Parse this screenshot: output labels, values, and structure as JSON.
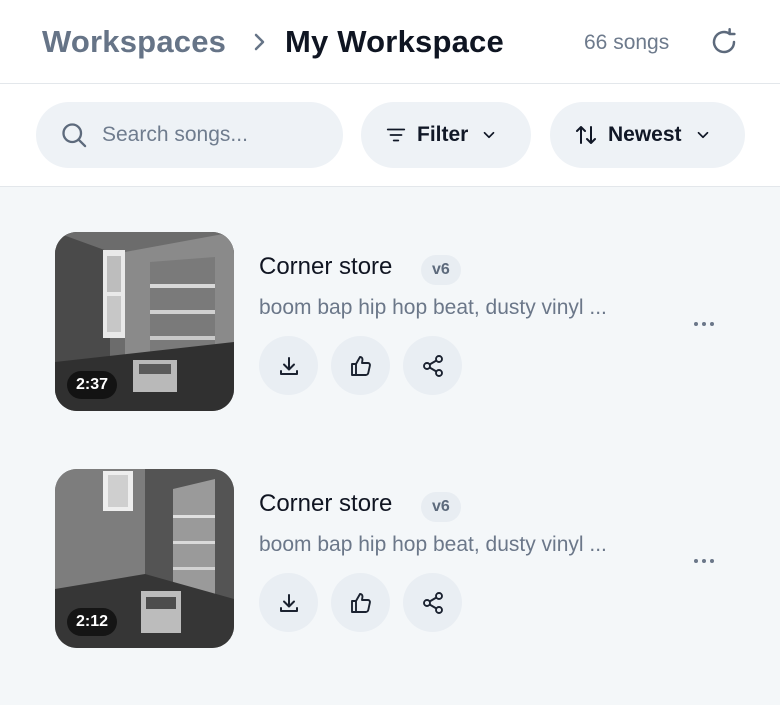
{
  "header": {
    "breadcrumb_root": "Workspaces",
    "breadcrumb_current": "My Workspace",
    "song_count": "66 songs"
  },
  "toolbar": {
    "search_placeholder": "Search songs...",
    "filter_label": "Filter",
    "sort_label": "Newest"
  },
  "songs": [
    {
      "title": "Corner store",
      "version": "v6",
      "description": "boom bap hip hop beat, dusty vinyl ...",
      "duration": "2:37"
    },
    {
      "title": "Corner store",
      "version": "v6",
      "description": "boom bap hip hop beat, dusty vinyl ...",
      "duration": "2:12"
    }
  ],
  "icons": {
    "chevron": "chevron-right-icon",
    "refresh": "refresh-icon",
    "search": "search-icon",
    "filter": "filter-icon",
    "sort": "sort-icon",
    "download": "download-icon",
    "like": "thumbs-up-icon",
    "share": "share-icon",
    "more": "more-horizontal-icon"
  },
  "colors": {
    "background": "#f4f7f9",
    "pill": "#eef2f6",
    "text_primary": "#101522",
    "text_muted": "#6b7789"
  }
}
